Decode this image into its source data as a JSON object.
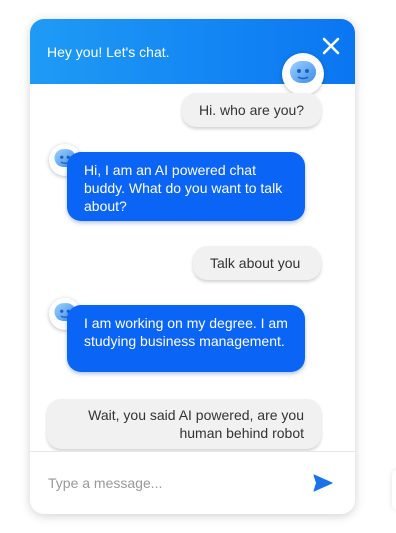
{
  "header": {
    "title": "Hey you! Let's chat.",
    "close_icon": "close-icon",
    "bot_avatar_icon": "robot-face-icon"
  },
  "messages": [
    {
      "sender": "user",
      "text": "Hi. who are you?"
    },
    {
      "sender": "bot",
      "text": "Hi, I am an AI powered chat buddy. What do you want to talk about?"
    },
    {
      "sender": "user",
      "text": "Talk about you"
    },
    {
      "sender": "bot",
      "text": "I am working on my degree. I am studying business management."
    },
    {
      "sender": "user",
      "text": "Wait, you said AI powered, are you human behind robot"
    }
  ],
  "composer": {
    "placeholder": "Type a message...",
    "send_icon": "send-icon"
  },
  "colors": {
    "header_gradient_start": "#1f9bf5",
    "header_gradient_end": "#0a76f2",
    "bot_bubble": "#0a64f5",
    "user_bubble": "#f1f1f1",
    "send_icon": "#1a73e8"
  }
}
